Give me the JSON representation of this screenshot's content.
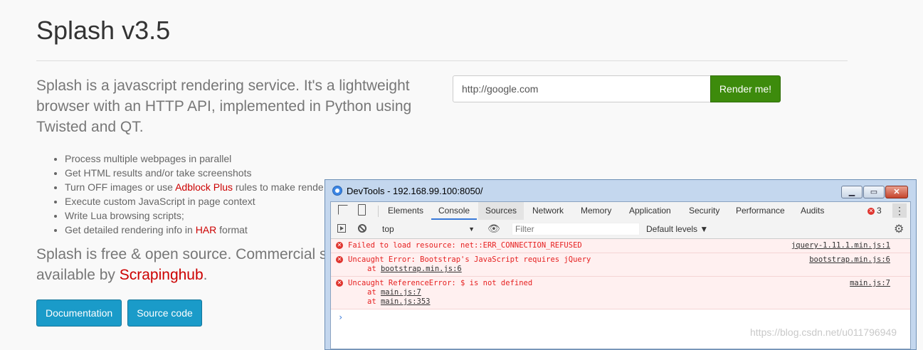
{
  "page": {
    "title": "Splash v3.5",
    "lead": "Splash is a javascript rendering service. It's a lightweight browser with an HTTP API, implemented in Python using Twisted and QT.",
    "features": [
      "Process multiple webpages in parallel",
      "Get HTML results and/or take screenshots"
    ],
    "feature3": {
      "pre": "Turn OFF images or use ",
      "link": "Adblock Plus",
      "post": " rules to make rende"
    },
    "feature4": "Execute custom JavaScript in page context",
    "feature5": "Write Lua browsing scripts;",
    "feature6": {
      "pre": "Get detailed rendering info in ",
      "link": "HAR",
      "post": " format"
    },
    "lead2": {
      "pre": "Splash is free & open source. Commercial s",
      "line2_pre": "available by ",
      "link": "Scrapinghub",
      "post": "."
    },
    "buttons": {
      "docs": "Documentation",
      "source": "Source code"
    },
    "url_input": {
      "value": "http://google.com"
    },
    "render_button": "Render me!"
  },
  "devtools": {
    "window_title": "DevTools - 192.168.99.100:8050/",
    "tabs": [
      "Elements",
      "Console",
      "Sources",
      "Network",
      "Memory",
      "Application",
      "Security",
      "Performance",
      "Audits"
    ],
    "active_tab": "Console",
    "error_count": "3",
    "context": "top",
    "filter_placeholder": "Filter",
    "levels": "Default levels ▼",
    "messages": [
      {
        "text": "Failed to load resource: net::ERR_CONNECTION_REFUSED",
        "source": "jquery-1.11.1.min.js:1"
      },
      {
        "text": "Uncaught Error: Bootstrap's JavaScript requires jQuery",
        "source": "bootstrap.min.js:6",
        "stack_prefix": "at ",
        "stack": [
          "bootstrap.min.js:6"
        ]
      },
      {
        "text": "Uncaught ReferenceError: $ is not defined",
        "source": "main.js:7",
        "stack_prefix": "at ",
        "stack": [
          "main.js:7",
          "main.js:353"
        ]
      }
    ],
    "prompt": "›"
  },
  "watermark": "https://blog.csdn.net/u011796949"
}
